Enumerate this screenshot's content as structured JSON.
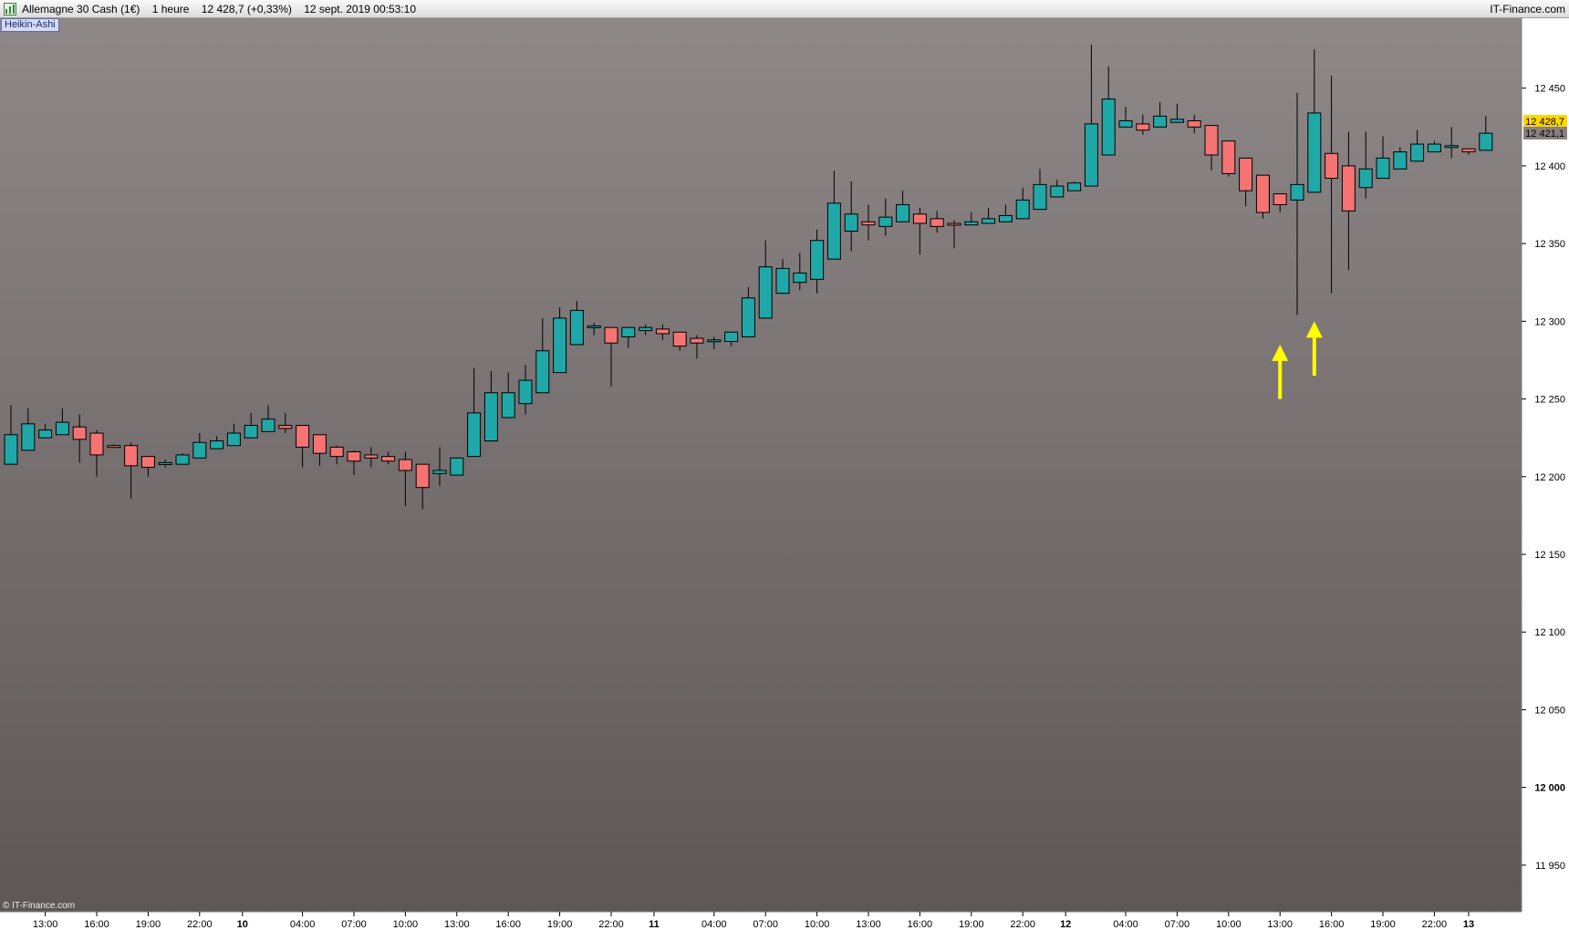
{
  "header": {
    "instrument": "Allemagne 30 Cash (1€)",
    "timeframe": "1 heure",
    "last_quote": "12 428,7 (+0,33%)",
    "datetime": "12 sept. 2019 00:53:10",
    "brand": "IT-Finance.com"
  },
  "indicator_label": "Heikin-Ashi",
  "watermark": "© IT-Finance.com",
  "colors": {
    "bull": "#20a8a8",
    "bear": "#f57373",
    "bg_top": "#8f8888",
    "bg_bottom": "#5e5757",
    "arrow": "#ffff00",
    "last_price_box": "#ffd700",
    "ha_close_box": "#8a8080"
  },
  "chart_data": {
    "type": "candlestick",
    "subtype": "heikin-ashi",
    "ylim": [
      11920,
      12495
    ],
    "y_ticks": [
      {
        "value": 12450,
        "label": "12 450"
      },
      {
        "value": 12400,
        "label": "12 400"
      },
      {
        "value": 12350,
        "label": "12 350"
      },
      {
        "value": 12300,
        "label": "12 300"
      },
      {
        "value": 12250,
        "label": "12 250"
      },
      {
        "value": 12200,
        "label": "12 200"
      },
      {
        "value": 12150,
        "label": "12 150"
      },
      {
        "value": 12100,
        "label": "12 100"
      },
      {
        "value": 12050,
        "label": "12 050"
      },
      {
        "value": 12000,
        "label": "12 000",
        "bold": true
      },
      {
        "value": 11950,
        "label": "11 950"
      }
    ],
    "x_ticks": [
      {
        "index": 2,
        "label": "13:00"
      },
      {
        "index": 5,
        "label": "16:00"
      },
      {
        "index": 8,
        "label": "19:00"
      },
      {
        "index": 11,
        "label": "22:00"
      },
      {
        "index": 13.5,
        "label": "10",
        "bold": true
      },
      {
        "index": 17,
        "label": "04:00"
      },
      {
        "index": 20,
        "label": "07:00"
      },
      {
        "index": 23,
        "label": "10:00"
      },
      {
        "index": 26,
        "label": "13:00"
      },
      {
        "index": 29,
        "label": "16:00"
      },
      {
        "index": 32,
        "label": "19:00"
      },
      {
        "index": 35,
        "label": "22:00"
      },
      {
        "index": 37.5,
        "label": "11",
        "bold": true
      },
      {
        "index": 41,
        "label": "04:00"
      },
      {
        "index": 44,
        "label": "07:00"
      },
      {
        "index": 47,
        "label": "10:00"
      },
      {
        "index": 50,
        "label": "13:00"
      },
      {
        "index": 53,
        "label": "16:00"
      },
      {
        "index": 56,
        "label": "19:00"
      },
      {
        "index": 59,
        "label": "22:00"
      },
      {
        "index": 61.5,
        "label": "12",
        "bold": true
      },
      {
        "index": 65,
        "label": "04:00"
      },
      {
        "index": 68,
        "label": "07:00"
      },
      {
        "index": 71,
        "label": "10:00"
      },
      {
        "index": 74,
        "label": "13:00"
      },
      {
        "index": 77,
        "label": "16:00"
      },
      {
        "index": 80,
        "label": "19:00"
      },
      {
        "index": 83,
        "label": "22:00"
      },
      {
        "index": 85,
        "label": "13",
        "bold": true
      }
    ],
    "price_labels": [
      {
        "value": 12428.7,
        "label": "12 428,7",
        "style": "last"
      },
      {
        "value": 12421.1,
        "label": "12 421,1",
        "style": "ha"
      }
    ],
    "annotations": [
      {
        "type": "arrow-up",
        "index": 74,
        "y_from": 12250,
        "y_to": 12285
      },
      {
        "type": "arrow-up",
        "index": 76,
        "y_from": 12265,
        "y_to": 12300
      }
    ],
    "candles": [
      [
        12208,
        12227,
        12246,
        12208
      ],
      [
        12217,
        12234,
        12244,
        12217
      ],
      [
        12225,
        12230,
        12234,
        12225
      ],
      [
        12227,
        12235,
        12244,
        12227
      ],
      [
        12232,
        12224,
        12240,
        12209
      ],
      [
        12228,
        12214,
        12230,
        12200
      ],
      [
        12220,
        12219,
        12221,
        12219
      ],
      [
        12220,
        12207,
        12222,
        12186
      ],
      [
        12213,
        12206,
        12213,
        12200
      ],
      [
        12209,
        12209,
        12211,
        12206
      ],
      [
        12208,
        12214,
        12215,
        12208
      ],
      [
        12212,
        12222,
        12228,
        12212
      ],
      [
        12218,
        12223,
        12226,
        12218
      ],
      [
        12220,
        12228,
        12234,
        12220
      ],
      [
        12225,
        12233,
        12241,
        12225
      ],
      [
        12229,
        12237,
        12246,
        12229
      ],
      [
        12233,
        12231,
        12241,
        12228
      ],
      [
        12233,
        12219,
        12233,
        12206
      ],
      [
        12227,
        12215,
        12227,
        12207
      ],
      [
        12219,
        12213,
        12220,
        12208
      ],
      [
        12216,
        12210,
        12217,
        12201
      ],
      [
        12214,
        12212,
        12219,
        12206
      ],
      [
        12213,
        12210,
        12216,
        12208
      ],
      [
        12211,
        12204,
        12216,
        12181
      ],
      [
        12208,
        12193,
        12208,
        12179
      ],
      [
        12202,
        12204,
        12219,
        12194
      ],
      [
        12201,
        12212,
        12211,
        12201
      ],
      [
        12213,
        12241,
        12270,
        12213
      ],
      [
        12223,
        12254,
        12268,
        12223
      ],
      [
        12238,
        12254,
        12267,
        12238
      ],
      [
        12247,
        12262,
        12272,
        12240
      ],
      [
        12254,
        12281,
        12302,
        12254
      ],
      [
        12267,
        12302,
        12309,
        12267
      ],
      [
        12285,
        12307,
        12313,
        12285
      ],
      [
        12296,
        12297,
        12299,
        12291
      ],
      [
        12296,
        12286,
        12296,
        12258
      ],
      [
        12290,
        12296,
        12296,
        12283
      ],
      [
        12294,
        12296,
        12298,
        12291
      ],
      [
        12295,
        12292,
        12298,
        12288
      ],
      [
        12293,
        12284,
        12293,
        12281
      ],
      [
        12289,
        12286,
        12291,
        12276
      ],
      [
        12287,
        12288,
        12290,
        12282
      ],
      [
        12287,
        12293,
        12292,
        12284
      ],
      [
        12290,
        12315,
        12322,
        12290
      ],
      [
        12302,
        12335,
        12352,
        12302
      ],
      [
        12318,
        12334,
        12340,
        12318
      ],
      [
        12325,
        12331,
        12344,
        12320
      ],
      [
        12327,
        12352,
        12359,
        12318
      ],
      [
        12340,
        12376,
        12397,
        12340
      ],
      [
        12358,
        12369,
        12390,
        12345
      ],
      [
        12364,
        12362,
        12375,
        12352
      ],
      [
        12361,
        12367,
        12379,
        12355
      ],
      [
        12364,
        12375,
        12384,
        12364
      ],
      [
        12369,
        12363,
        12373,
        12343
      ],
      [
        12366,
        12361,
        12371,
        12357
      ],
      [
        12363,
        12362,
        12365,
        12347
      ],
      [
        12362,
        12364,
        12370,
        12362
      ],
      [
        12363,
        12366,
        12373,
        12363
      ],
      [
        12364,
        12368,
        12375,
        12364
      ],
      [
        12366,
        12378,
        12386,
        12366
      ],
      [
        12372,
        12388,
        12398,
        12372
      ],
      [
        12380,
        12387,
        12391,
        12380
      ],
      [
        12384,
        12389,
        12390,
        12384
      ],
      [
        12387,
        12427,
        12478,
        12387
      ],
      [
        12407,
        12443,
        12464,
        12407
      ],
      [
        12425,
        12429,
        12438,
        12425
      ],
      [
        12427,
        12423,
        12433,
        12420
      ],
      [
        12425,
        12432,
        12441,
        12425
      ],
      [
        12428,
        12430,
        12440,
        12428
      ],
      [
        12429,
        12425,
        12433,
        12421
      ],
      [
        12426,
        12407,
        12426,
        12397
      ],
      [
        12416,
        12395,
        12416,
        12393
      ],
      [
        12405,
        12384,
        12405,
        12374
      ],
      [
        12394,
        12370,
        12394,
        12366
      ],
      [
        12382,
        12375,
        12382,
        12370
      ],
      [
        12378,
        12388,
        12447,
        12304
      ],
      [
        12383,
        12434,
        12475,
        12383
      ],
      [
        12408,
        12392,
        12458,
        12318
      ],
      [
        12400,
        12371,
        12422,
        12333
      ],
      [
        12386,
        12398,
        12422,
        12379
      ],
      [
        12392,
        12405,
        12419,
        12392
      ],
      [
        12398,
        12409,
        12412,
        12398
      ],
      [
        12403,
        12414,
        12423,
        12403
      ],
      [
        12409,
        12414,
        12416,
        12409
      ],
      [
        12413,
        12413,
        12425,
        12405
      ],
      [
        12411,
        12409,
        12411,
        12407
      ],
      [
        12410,
        12421,
        12432,
        12410
      ]
    ]
  }
}
